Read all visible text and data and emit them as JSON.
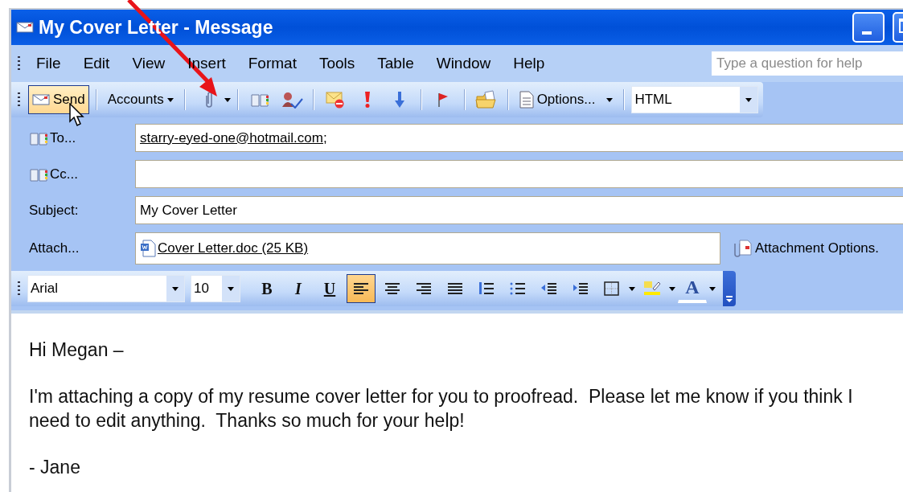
{
  "window": {
    "title": "My Cover Letter - Message"
  },
  "menu": [
    {
      "label": "File"
    },
    {
      "label": "Edit"
    },
    {
      "label": "View"
    },
    {
      "label": "Insert"
    },
    {
      "label": "Format"
    },
    {
      "label": "Tools"
    },
    {
      "label": "Table"
    },
    {
      "label": "Window"
    },
    {
      "label": "Help"
    }
  ],
  "help_search": {
    "placeholder": "Type a question for help"
  },
  "toolbar": {
    "send": {
      "label": "Send",
      "highlighted": true
    },
    "accounts": {
      "label": "Accounts"
    },
    "options": {
      "label": "Options..."
    },
    "format": {
      "value": "HTML"
    }
  },
  "fields": [
    {
      "kind": "address",
      "label": "To...",
      "value": "starry-eyed-one@hotmail.com",
      "suffix": ";"
    },
    {
      "kind": "address",
      "label": "Cc..."
    },
    {
      "kind": "text",
      "label": "Subject:",
      "value": "My Cover Letter"
    },
    {
      "kind": "attachment",
      "label": "Attach...",
      "value": "Cover Letter.doc (25 KB)",
      "options_label": "Attachment Options."
    }
  ],
  "format_bar": {
    "font": "Arial",
    "size": "10",
    "buttons": [
      {
        "kind": "bold",
        "label": "B",
        "selected": false
      },
      {
        "kind": "italic",
        "label": "I",
        "selected": false
      },
      {
        "kind": "underline",
        "label": "U",
        "selected": false
      },
      {
        "kind": "align-left",
        "selected": true
      },
      {
        "kind": "align-center",
        "selected": false
      },
      {
        "kind": "align-right",
        "selected": false
      },
      {
        "kind": "justify",
        "selected": false
      },
      {
        "kind": "numbering",
        "selected": false
      },
      {
        "kind": "bullets",
        "selected": false
      },
      {
        "kind": "outdent",
        "selected": false
      },
      {
        "kind": "indent",
        "selected": false
      },
      {
        "kind": "border",
        "selected": false
      },
      {
        "kind": "highlight",
        "selected": false
      },
      {
        "kind": "font-color",
        "label": "A",
        "selected": false
      }
    ]
  },
  "body": [
    "Hi Megan –",
    "I'm attaching a copy of my resume cover letter for you to proofread.  Please let me know if you think I need to edit anything.  Thanks so much for your help!",
    "- Jane"
  ]
}
